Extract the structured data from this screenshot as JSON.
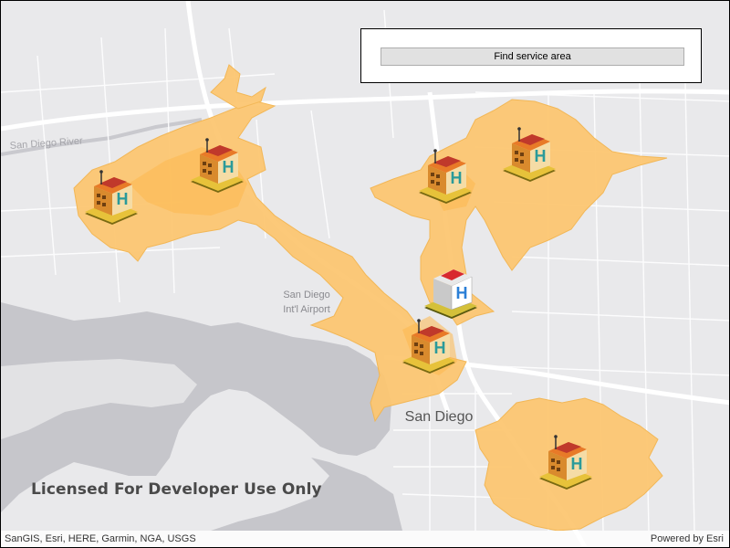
{
  "toolbar": {
    "find_service_area_label": "Find service area"
  },
  "map": {
    "place_labels": {
      "river": "San Diego River",
      "airport_line1": "San Diego",
      "airport_line2": "Int'l Airport",
      "city": "San Diego"
    },
    "watermark": "Licensed For Developer Use Only",
    "attribution": "SanGIS, Esri, HERE, Garmin, NGA, USGS",
    "powered_by": "Powered by Esri",
    "facility_icon": "hospital-icon",
    "facility_count": 7,
    "colors": {
      "water": "#c6c6cb",
      "land": "#e9e9eb",
      "road": "#ffffff",
      "service_area_fill": "#fcc772",
      "service_area_inner": "#fdb84e"
    }
  }
}
